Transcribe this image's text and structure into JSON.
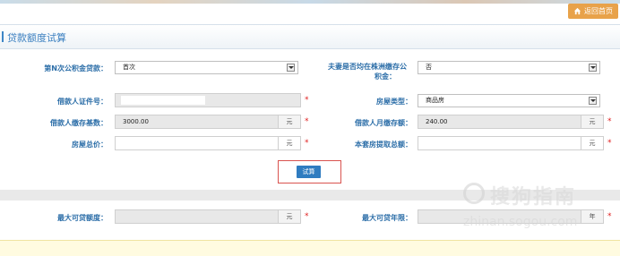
{
  "header": {
    "return_label": "返回首页"
  },
  "panel": {
    "title": "贷款额度试算"
  },
  "form": {
    "nth_loan": {
      "label": "第N次公积金贷款：",
      "value": "首次"
    },
    "couple_deposit": {
      "label_line1": "夫妻是否均在株洲缴存公",
      "label_line2": "积金：",
      "value": "否"
    },
    "borrower_id": {
      "label": "借款人证件号：",
      "value": ""
    },
    "house_type": {
      "label": "房屋类型：",
      "value": "商品房"
    },
    "deposit_base": {
      "label": "借款人缴存基数：",
      "value": "3000.00",
      "unit": "元"
    },
    "monthly_deposit": {
      "label": "借款人月缴存额：",
      "value": "240.00",
      "unit": "元"
    },
    "house_price": {
      "label": "房屋总价：",
      "value": "",
      "unit": "元"
    },
    "withdraw_total": {
      "label": "本套房提取总额：",
      "value": "",
      "unit": "元"
    },
    "required_mark": "*",
    "calc_label": "试算"
  },
  "result": {
    "max_amount": {
      "label": "最大可贷额度：",
      "value": "",
      "unit": "元"
    },
    "max_years": {
      "label": "最大可贷年限：",
      "value": "",
      "unit": "年"
    }
  },
  "watermark": {
    "text": "搜狗指南",
    "url": "zhinan.sogou.com"
  }
}
